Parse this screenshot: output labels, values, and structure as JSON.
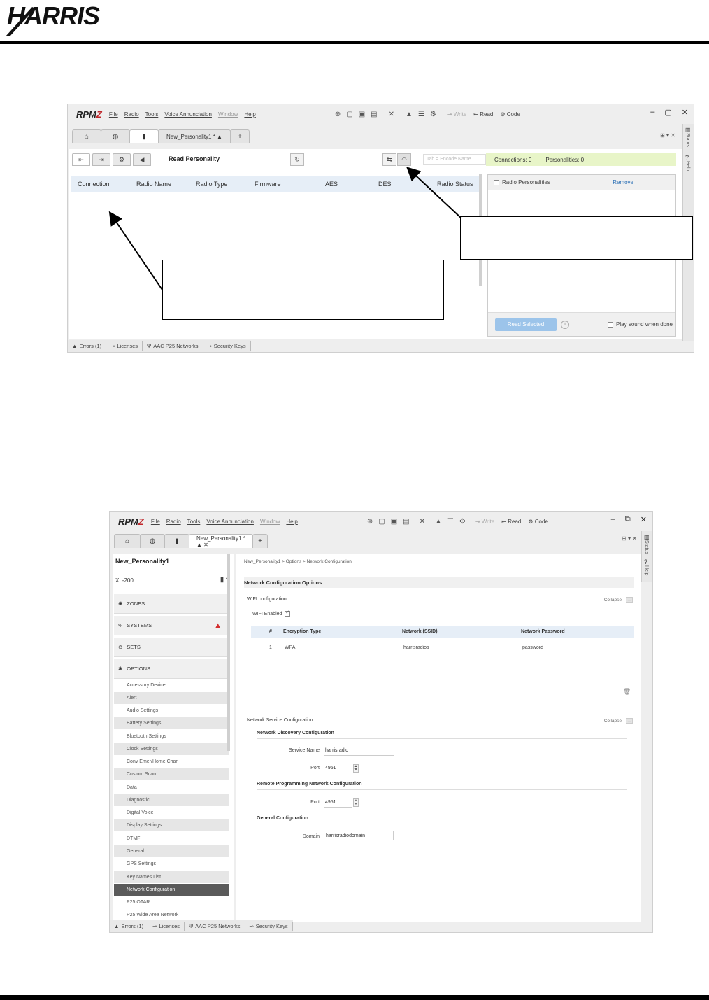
{
  "page": {
    "logo_text": "HARRIS"
  },
  "window1": {
    "brand_prefix": "RPM",
    "brand_suffix": "Z",
    "menu": [
      "File",
      "Radio",
      "Tools",
      "Voice Annunciation",
      "Window",
      "Help"
    ],
    "toolbar": {
      "write": "Write",
      "read": "Read",
      "code": "Code"
    },
    "doc_tab": "New_Personality1 * ▲",
    "add_tab": "+",
    "read_personality": "Read Personality",
    "filter_placeholder": "Tab = Encode Name",
    "connections": "Connections: 0",
    "personalities": "Personalities: 0",
    "columns": [
      "Connection",
      "Radio Name",
      "Radio Type",
      "Firmware",
      "AES",
      "DES",
      "Radio Status"
    ],
    "radio_personalities": "Radio Personalities",
    "remove": "Remove",
    "read_selected": "Read Selected",
    "play_sound": "Play sound when done",
    "side_status": "Status",
    "side_help": "Help",
    "statusbar": [
      "Errors (1)",
      "Licenses",
      "AAC P25 Networks",
      "Security Keys"
    ]
  },
  "window2": {
    "brand_prefix": "RPM",
    "brand_suffix": "Z",
    "menu": [
      "File",
      "Radio",
      "Tools",
      "Voice Annunciation",
      "Window",
      "Help"
    ],
    "toolbar": {
      "write": "Write",
      "read": "Read",
      "code": "Code"
    },
    "doc_tab": "New_Personality1 * ▲ ✕",
    "add_tab": "+",
    "personality_title": "New_Personality1",
    "model": "XL-200",
    "sections": [
      {
        "label": "ZONES"
      },
      {
        "label": "SYSTEMS"
      },
      {
        "label": "SETS"
      },
      {
        "label": "OPTIONS"
      }
    ],
    "options": [
      "Accessory Device",
      "Alert",
      "Audio Settings",
      "Battery Settings",
      "Bluetooth Settings",
      "Clock Settings",
      "Conv Emer/Home Chan",
      "Custom Scan",
      "Data",
      "Diagnostic",
      "Digital Voice",
      "Display Settings",
      "DTMF",
      "General",
      "GPS Settings",
      "Key Names List",
      "Network Configuration",
      "P25 OTAR",
      "P25 Wide Area Network"
    ],
    "breadcrumb": "New_Personality1 > Options > Network Configuration",
    "options_heading": "Network Configuration Options",
    "wifi_heading": "WIFI configuration",
    "collapse": "Collapse",
    "wifi_enabled": "WIFI Enabled",
    "table_headers": [
      "#",
      "Encryption Type",
      "Network (SSID)",
      "Network Password"
    ],
    "table_row": [
      "1",
      "WPA",
      "harrisradios",
      "password"
    ],
    "nsc_heading": "Network Service Configuration",
    "ndc_heading": "Network Discovery Configuration",
    "service_name_label": "Service Name",
    "service_name_value": "harrisradio",
    "port_label": "Port",
    "port1_value": "4951",
    "rpn_heading": "Remote Programming Network Configuration",
    "port2_value": "4951",
    "general_heading": "General Configuration",
    "domain_label": "Domain",
    "domain_value": "harrisradiodomain",
    "side_status": "Status",
    "side_help": "Help",
    "statusbar": [
      "Errors (1)",
      "Licenses",
      "AAC P25 Networks",
      "Security Keys"
    ]
  }
}
